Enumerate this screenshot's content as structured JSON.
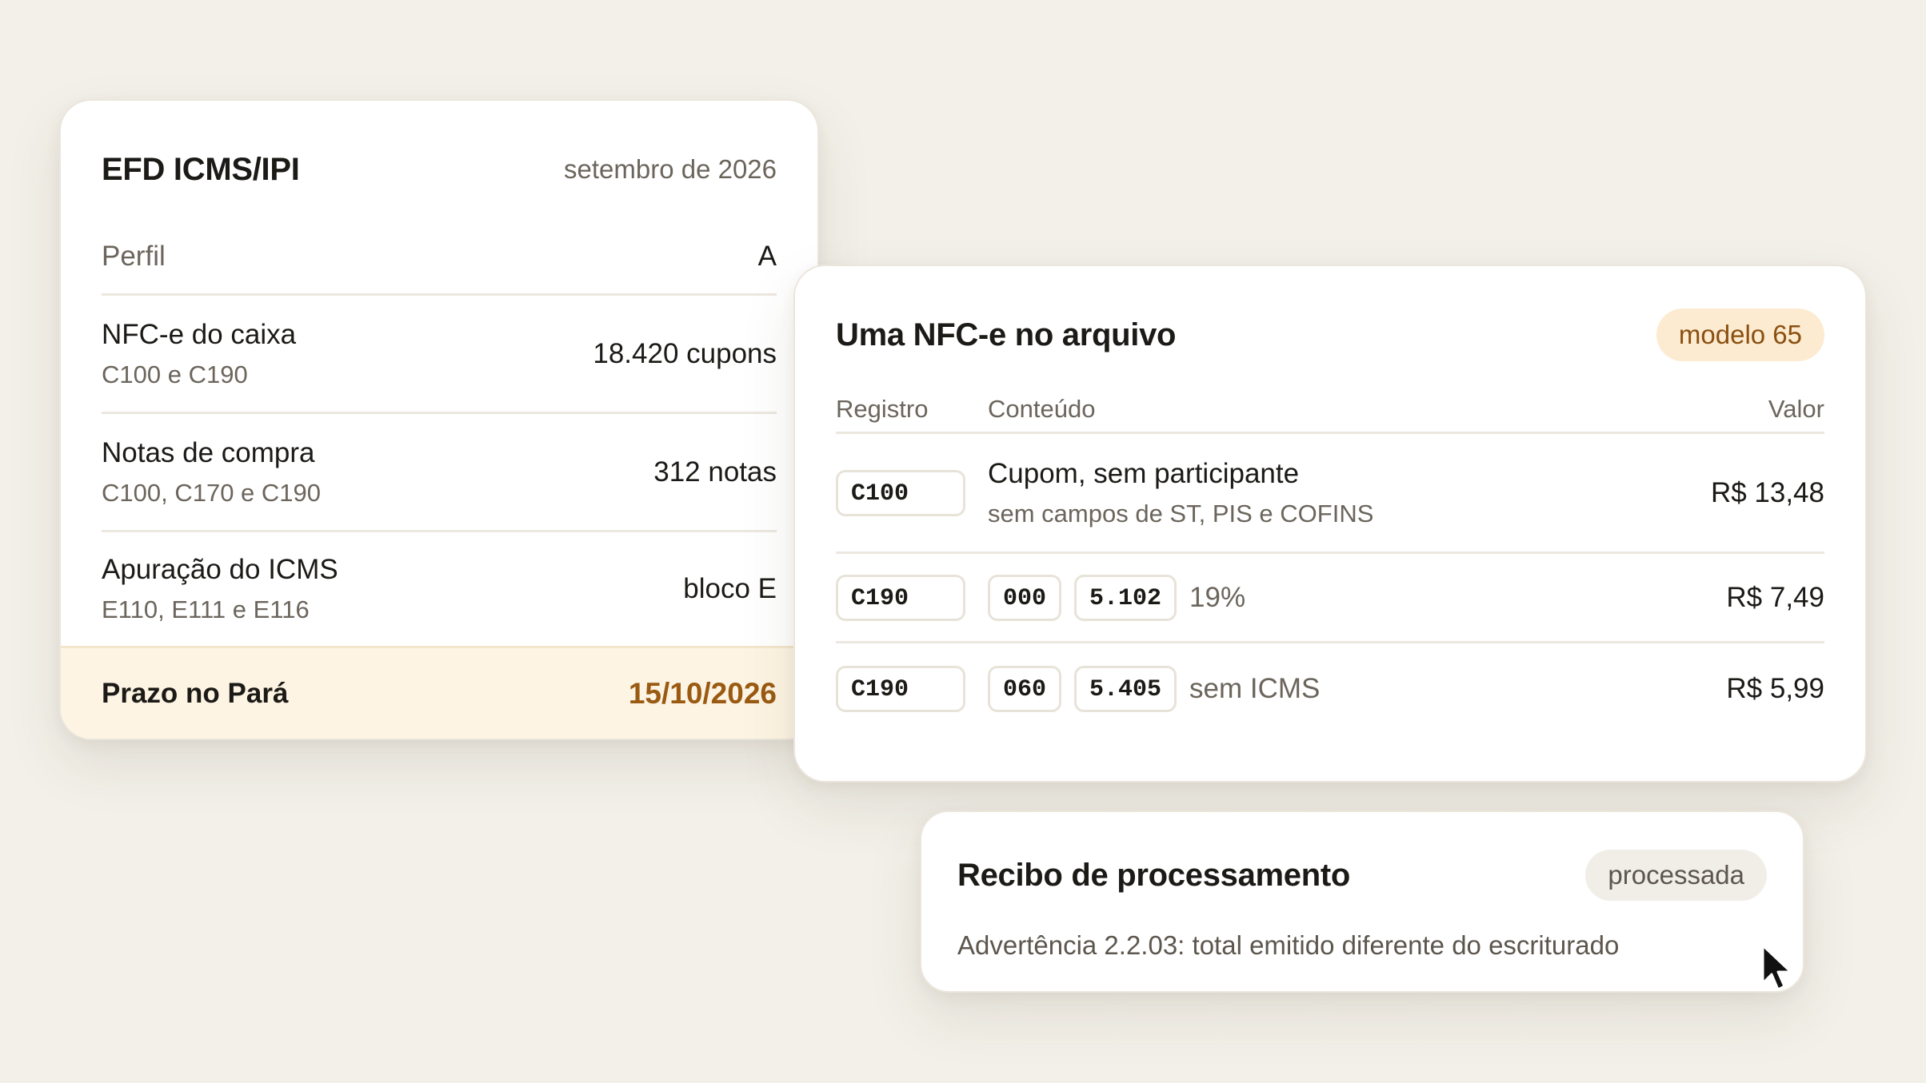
{
  "efd": {
    "title": "EFD ICMS/IPI",
    "period": "setembro de 2026",
    "profile": {
      "label": "Perfil",
      "value": "A"
    },
    "rows": [
      {
        "label": "NFC-e do caixa",
        "sub": "C100 e C190",
        "value": "18.420 cupons"
      },
      {
        "label": "Notas de compra",
        "sub": "C100, C170 e C190",
        "value": "312 notas"
      },
      {
        "label": "Apuração do ICMS",
        "sub": "E110, E111 e E116",
        "value": "bloco E"
      }
    ],
    "deadline": {
      "label": "Prazo no Pará",
      "date": "15/10/2026"
    }
  },
  "nfce": {
    "title": "Uma NFC-e no arquivo",
    "badge": "modelo 65",
    "columns": {
      "registro": "Registro",
      "conteudo": "Conteúdo",
      "valor": "Valor"
    },
    "records": [
      {
        "code": "C100",
        "main": "Cupom, sem participante",
        "sub": "sem campos de ST, PIS e COFINS",
        "value": "R$ 13,48"
      },
      {
        "code": "C190",
        "cst": "000",
        "cfop": "5.102",
        "desc": "19%",
        "value": "R$ 7,49"
      },
      {
        "code": "C190",
        "cst": "060",
        "cfop": "5.405",
        "desc": "sem ICMS",
        "value": "R$ 5,99"
      }
    ]
  },
  "receipt": {
    "title": "Recibo de processamento",
    "status": "processada",
    "warning": "Advertência 2.2.03: total emitido diferente do escriturado"
  },
  "colors": {
    "background": "#f3f0e9",
    "accent": "#9a5a12",
    "badge_bg": "#fcebd0",
    "deadline_bg": "#fdf4e3"
  },
  "icons": {
    "cursor": "mouse-pointer-icon"
  }
}
